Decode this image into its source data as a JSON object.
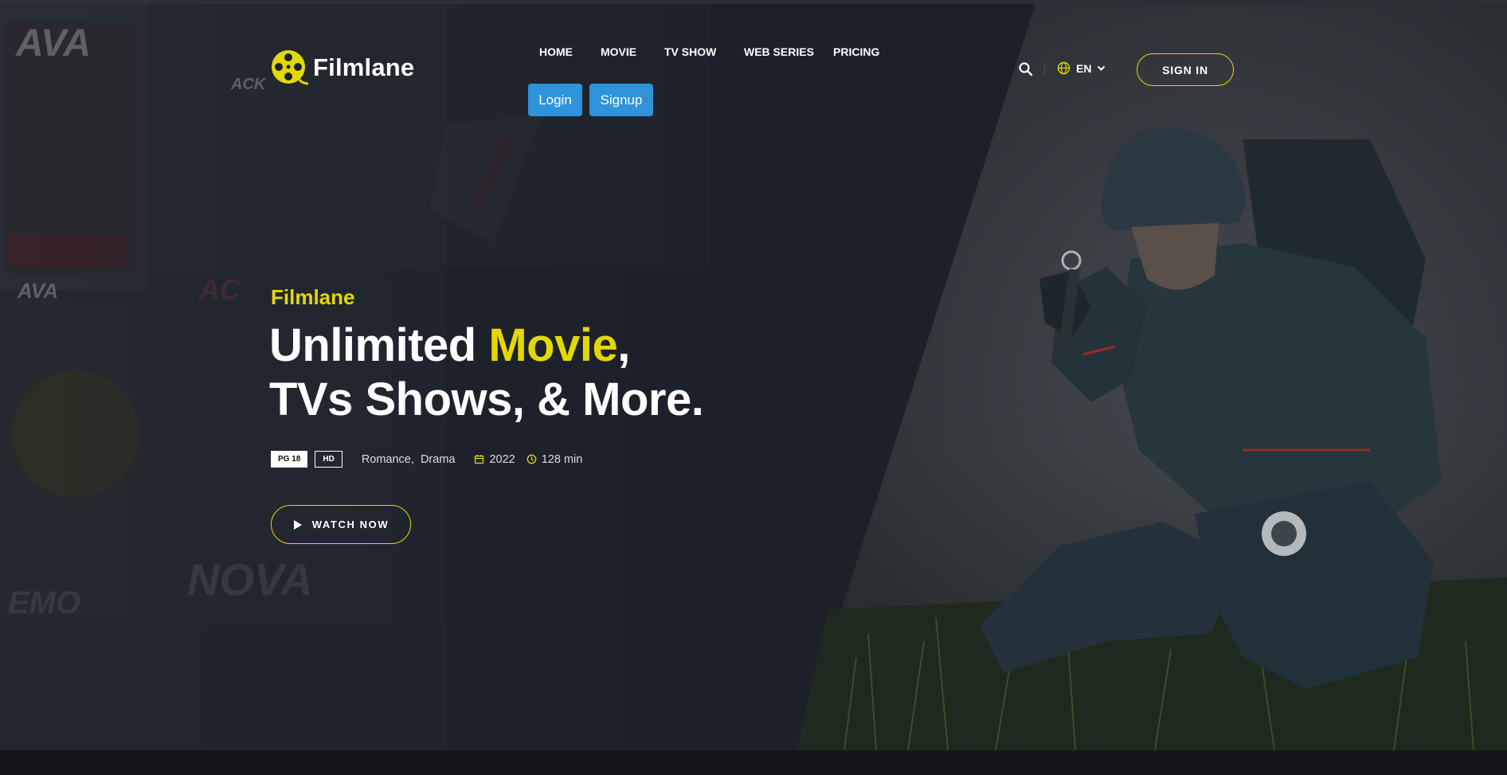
{
  "brand": {
    "name": "Filmlane",
    "accent": "#e4d804",
    "logo_icon": "film-reel-icon"
  },
  "nav": {
    "items": [
      {
        "label": "HOME"
      },
      {
        "label": "MOVIE"
      },
      {
        "label": "TV SHOW"
      },
      {
        "label": "WEB SERIES"
      },
      {
        "label": "PRICING"
      }
    ],
    "login_label": "Login",
    "signup_label": "Signup",
    "button_color": "#2f93d9"
  },
  "header_actions": {
    "search_icon": "search-icon",
    "language_icon": "globe-icon",
    "language": "EN",
    "signin_label": "SIGN IN"
  },
  "hero": {
    "eyebrow": "Filmlane",
    "headline_part1": "Unlimited ",
    "headline_highlight": "Movie",
    "headline_part2": ",",
    "headline_line2": "TVs Shows, & More.",
    "badges": [
      "PG 18",
      "HD"
    ],
    "genres": "Romance,  Drama",
    "year": "2022",
    "duration": "128 min",
    "watch_label": "WATCH NOW"
  },
  "background_poster_text": [
    "AVA",
    "AVA",
    "ACK",
    "NOVA",
    "EMO",
    "AC"
  ]
}
